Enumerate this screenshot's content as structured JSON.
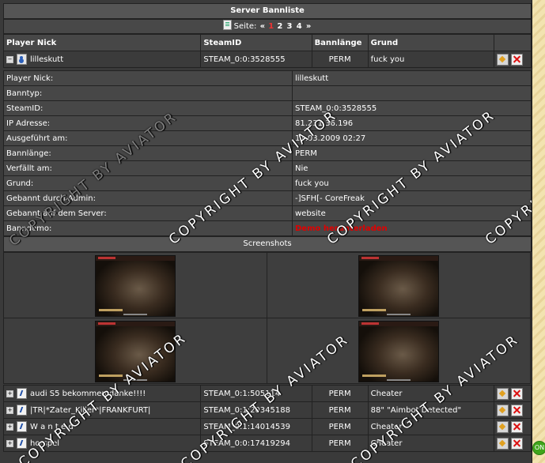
{
  "header": {
    "title": "Server Bannliste"
  },
  "pager": {
    "label": "Seite:",
    "prev": "«",
    "pages": [
      "1",
      "2",
      "3",
      "4"
    ],
    "current": "1",
    "next": "»"
  },
  "columns": {
    "nick": "Player Nick",
    "steamid": "SteamID",
    "length": "Bannlänge",
    "reason": "Grund"
  },
  "expanded": {
    "nick": "lilleskutt",
    "steamid": "STEAM_0:0:3528555",
    "length": "PERM",
    "reason": "fuck you"
  },
  "details": [
    {
      "label": "Player Nick:",
      "value": "lilleskutt"
    },
    {
      "label": "Banntyp:",
      "value": ""
    },
    {
      "label": "SteamID:",
      "value": "STEAM_0:0:3528555"
    },
    {
      "label": "IP Adresse:",
      "value": "81.231.36.196"
    },
    {
      "label": "Ausgeführt am:",
      "value": "11.03.2009 02:27"
    },
    {
      "label": "Bannlänge:",
      "value": "PERM"
    },
    {
      "label": "Verfällt am:",
      "value": "Nie"
    },
    {
      "label": "Grund:",
      "value": "fuck you"
    },
    {
      "label": "Gebannt durch Admin:",
      "value": "-]SFH[- CoreFreak"
    },
    {
      "label": "Gebannt auf dem Server:",
      "value": "website"
    },
    {
      "label": "Banndemo:",
      "value": "Demo herunterladen"
    }
  ],
  "screenshots": {
    "title": "Screenshots"
  },
  "rows": [
    {
      "nick": "audi S5 bekommen danke!!!!",
      "steamid": "STEAM_0:1:505114",
      "length": "PERM",
      "reason": "Cheater"
    },
    {
      "nick": "|TR|*Zater_Killer*|FRANKFURT|",
      "steamid": "STEAM_0:1:20345188",
      "length": "PERM",
      "reason": "88\" \"Aimbot Detected\""
    },
    {
      "nick": "W a n t e d",
      "steamid": "STEAM_0:1:14014539",
      "length": "PERM",
      "reason": "Cheater"
    },
    {
      "nick": "horspel",
      "steamid": "STEAM_0:0:17419294",
      "length": "PERM",
      "reason": "Cheater"
    }
  ],
  "watermark": "COPYRIGHT BY AVIATOR",
  "side_badge": "ON",
  "colors": {
    "demo_link": "#e00000",
    "page_current": "#e33333",
    "background": "#3a3a3a"
  }
}
